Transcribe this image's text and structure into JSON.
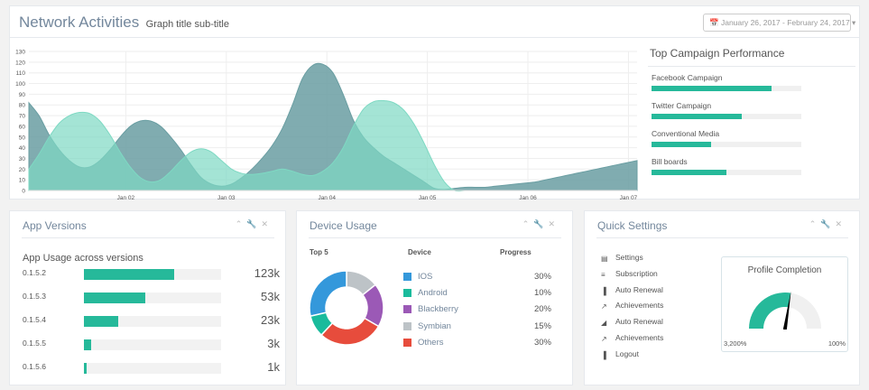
{
  "header": {
    "title": "Network Activities",
    "subtitle": "Graph title sub-title",
    "date_range": "January 26, 2017 - February 24, 2017"
  },
  "chart_data": {
    "type": "area",
    "x_ticks": [
      "Jan 02",
      "Jan 03",
      "Jan 04",
      "Jan 05",
      "Jan 06",
      "Jan 07"
    ],
    "y_ticks": [
      0,
      10,
      20,
      30,
      40,
      50,
      60,
      70,
      80,
      90,
      100,
      110,
      120,
      130
    ],
    "ylim": [
      0,
      130
    ],
    "series": [
      {
        "color": "#6a9ea2",
        "x": [
          0,
          1,
          2,
          3,
          4,
          5,
          6,
          7,
          8,
          9,
          10,
          11,
          12,
          13,
          14,
          15,
          16,
          17,
          18,
          19,
          20,
          21,
          22,
          23,
          24,
          25,
          26,
          27,
          28,
          29,
          30,
          31,
          32,
          33,
          34,
          35,
          36,
          37,
          38,
          39,
          40,
          41,
          42,
          43,
          44,
          45,
          46,
          47,
          48,
          49,
          50,
          51,
          52,
          53,
          54,
          55,
          56,
          57,
          58,
          59,
          60
        ],
        "y": [
          82,
          70,
          52,
          38,
          28,
          22,
          22,
          28,
          38,
          50,
          60,
          65,
          65,
          60,
          50,
          38,
          24,
          12,
          6,
          4,
          6,
          12,
          20,
          30,
          42,
          58,
          80,
          105,
          117,
          118,
          110,
          90,
          66,
          50,
          40,
          32,
          26,
          20,
          14,
          8,
          2,
          1,
          2,
          3,
          3,
          3,
          4,
          5,
          6,
          7,
          8,
          10,
          12,
          14,
          16,
          18,
          20,
          22,
          24,
          26,
          28
        ]
      },
      {
        "color": "#7ed9c3",
        "x": [
          0,
          1,
          2,
          3,
          4,
          5,
          6,
          7,
          8,
          9,
          10,
          11,
          12,
          13,
          14,
          15,
          16,
          17,
          18,
          19,
          20,
          21,
          22,
          23,
          24,
          25,
          26,
          27,
          28,
          29,
          30,
          31,
          32,
          33,
          34,
          35,
          36,
          37,
          38,
          39,
          40,
          41,
          42,
          43,
          44,
          45,
          46,
          47,
          48,
          49,
          50,
          51,
          52,
          53,
          54,
          55,
          56,
          57,
          58,
          59,
          60
        ],
        "y": [
          20,
          34,
          50,
          63,
          70,
          73,
          72,
          65,
          52,
          36,
          22,
          12,
          8,
          10,
          18,
          28,
          36,
          39,
          36,
          28,
          20,
          16,
          15,
          16,
          18,
          20,
          18,
          15,
          14,
          18,
          26,
          40,
          60,
          76,
          83,
          84,
          82,
          75,
          62,
          44,
          24,
          8,
          0,
          0,
          0,
          0,
          0,
          0,
          0,
          0,
          0,
          0,
          0,
          0,
          0,
          0,
          0,
          0,
          0,
          0,
          0
        ]
      }
    ]
  },
  "campaign": {
    "title": "Top Campaign Performance",
    "items": [
      {
        "label": "Facebook Campaign",
        "value": 80
      },
      {
        "label": "Twitter Campaign",
        "value": 60
      },
      {
        "label": "Conventional Media",
        "value": 40
      },
      {
        "label": "Bill boards",
        "value": 50
      }
    ]
  },
  "app_versions": {
    "title": "App Versions",
    "subtitle": "App Usage across versions",
    "rows": [
      {
        "version": "0.1.5.2",
        "count": "123k",
        "fill": 66
      },
      {
        "version": "0.1.5.3",
        "count": "53k",
        "fill": 45
      },
      {
        "version": "0.1.5.4",
        "count": "23k",
        "fill": 25
      },
      {
        "version": "0.1.5.5",
        "count": "3k",
        "fill": 5
      },
      {
        "version": "0.1.5.6",
        "count": "1k",
        "fill": 2
      }
    ]
  },
  "device_usage": {
    "title": "Device Usage",
    "col_top": "Top 5",
    "col_device": "Device",
    "col_progress": "Progress",
    "rows": [
      {
        "name": "IOS",
        "pct": "30%",
        "value": 30,
        "color": "#3498db"
      },
      {
        "name": "Android",
        "pct": "10%",
        "value": 10,
        "color": "#1abb9c"
      },
      {
        "name": "Blackberry",
        "pct": "20%",
        "value": 20,
        "color": "#9b59b6"
      },
      {
        "name": "Symbian",
        "pct": "15%",
        "value": 15,
        "color": "#bdc3c7"
      },
      {
        "name": "Others",
        "pct": "30%",
        "value": 30,
        "color": "#e74c3c"
      }
    ]
  },
  "quick_settings": {
    "title": "Quick Settings",
    "items": [
      {
        "label": "Settings",
        "icon": "calendar-icon"
      },
      {
        "label": "Subscription",
        "icon": "list-icon"
      },
      {
        "label": "Auto Renewal",
        "icon": "bar-chart-icon"
      },
      {
        "label": "Achievements",
        "icon": "line-chart-icon"
      },
      {
        "label": "Auto Renewal",
        "icon": "area-chart-icon"
      },
      {
        "label": "Achievements",
        "icon": "line-chart-icon"
      },
      {
        "label": "Logout",
        "icon": "bar-chart-icon"
      }
    ],
    "profile": {
      "title": "Profile Completion",
      "min_label": "3,200%",
      "max_label": "100%",
      "level": 0.55
    }
  },
  "colors": {
    "accent": "#26b99a",
    "text": "#73879c"
  }
}
